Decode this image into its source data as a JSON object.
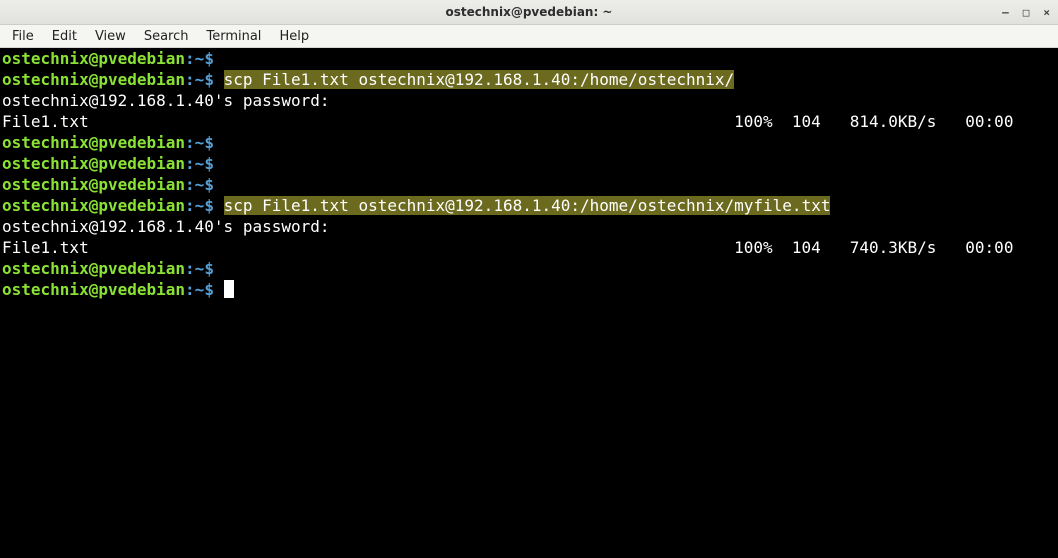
{
  "window": {
    "title": "ostechnix@pvedebian: ~",
    "controls": {
      "min": "–",
      "max": "□",
      "close": "×"
    }
  },
  "menu": {
    "items": [
      "File",
      "Edit",
      "View",
      "Search",
      "Terminal",
      "Help"
    ]
  },
  "prompt": {
    "userhost": "ostechnix@pvedebian",
    "sep": ":",
    "path": "~",
    "sigil": "$"
  },
  "session": {
    "cmd1": "scp File1.txt ostechnix@192.168.1.40:/home/ostechnix/",
    "pwline": "ostechnix@192.168.1.40's password:",
    "file": "File1.txt",
    "stat1": "100%  104   814.0KB/s   00:00",
    "cmd2": "scp File1.txt ostechnix@192.168.1.40:/home/ostechnix/myfile.txt",
    "stat2": "100%  104   740.3KB/s   00:00"
  }
}
